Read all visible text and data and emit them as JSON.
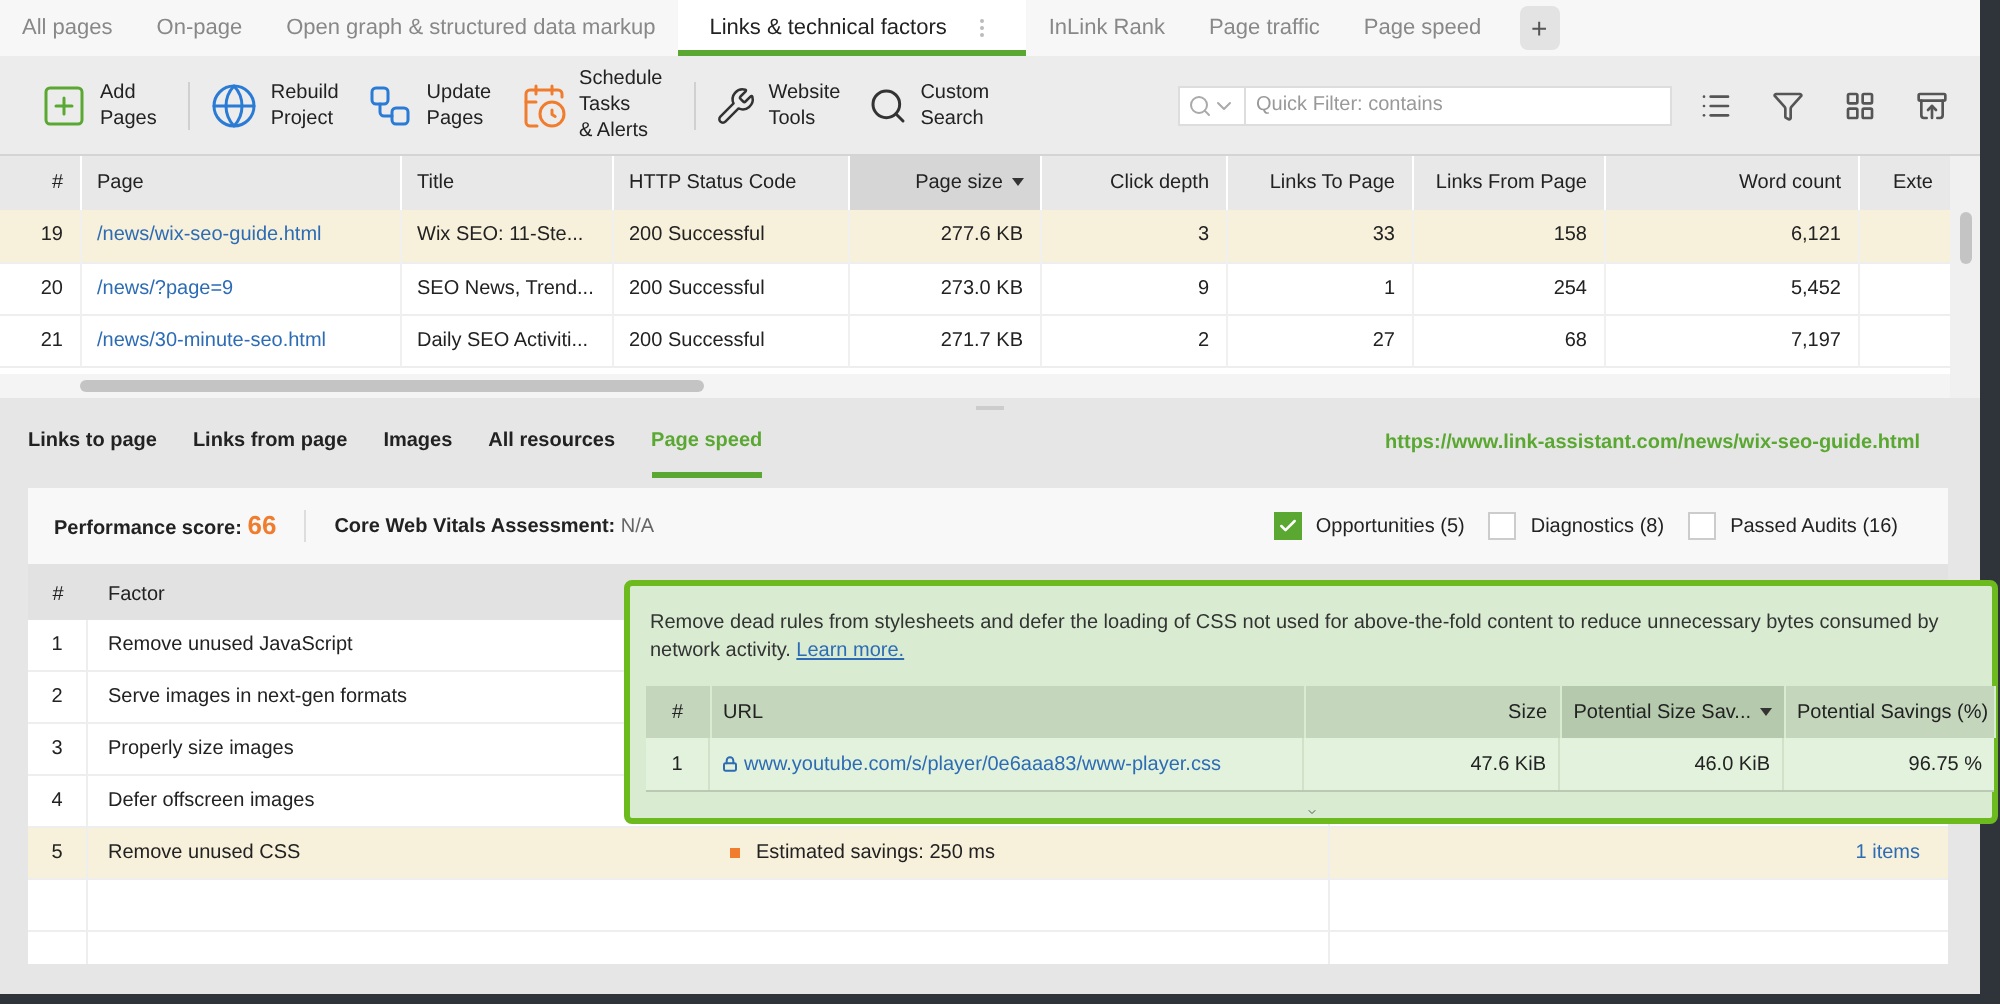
{
  "tabs": [
    {
      "label": "All pages",
      "selected": false
    },
    {
      "label": "On-page",
      "selected": false
    },
    {
      "label": "Open graph & structured data markup",
      "selected": false
    },
    {
      "label": "Links & technical factors",
      "selected": true
    },
    {
      "label": "InLink Rank",
      "selected": false
    },
    {
      "label": "Page traffic",
      "selected": false
    },
    {
      "label": "Page speed",
      "selected": false
    }
  ],
  "add_tab": "+",
  "toolbar": [
    {
      "kind": "add",
      "label": "Add\nPages"
    },
    {
      "kind": "rebuild",
      "label": "Rebuild\nProject"
    },
    {
      "kind": "update",
      "label": "Update\nPages"
    },
    {
      "kind": "schedule",
      "label": "Schedule\nTasks\n& Alerts"
    },
    {
      "kind": "tools",
      "label": "Website\nTools"
    },
    {
      "kind": "search",
      "label": "Custom\nSearch"
    }
  ],
  "quick_filter": {
    "placeholder": "Quick Filter: contains"
  },
  "table": {
    "columns": [
      {
        "label": "#",
        "sorted": false
      },
      {
        "label": "Page",
        "sorted": false
      },
      {
        "label": "Title",
        "sorted": false
      },
      {
        "label": "HTTP Status Code",
        "sorted": false
      },
      {
        "label": "Page size",
        "sorted": true
      },
      {
        "label": "Click depth",
        "sorted": false
      },
      {
        "label": "Links To Page",
        "sorted": false
      },
      {
        "label": "Links From Page",
        "sorted": false
      },
      {
        "label": "Word count",
        "sorted": false
      },
      {
        "label": "Exte",
        "sorted": false
      }
    ],
    "rows": [
      {
        "selected": true,
        "cells": [
          "19",
          "/news/wix-seo-guide.html",
          "Wix SEO: 11-Ste...",
          "200 Successful",
          "277.6 KB",
          "3",
          "33",
          "158",
          "6,121",
          ""
        ]
      },
      {
        "selected": false,
        "cells": [
          "20",
          "/news/?page=9",
          "SEO News, Trend...",
          "200 Successful",
          "273.0 KB",
          "9",
          "1",
          "254",
          "5,452",
          ""
        ]
      },
      {
        "selected": false,
        "cells": [
          "21",
          "/news/30-minute-seo.html",
          "Daily SEO Activiti...",
          "200 Successful",
          "271.7 KB",
          "2",
          "27",
          "68",
          "7,197",
          ""
        ]
      }
    ]
  },
  "detail_tabs": [
    {
      "label": "Links to page",
      "selected": false
    },
    {
      "label": "Links from page",
      "selected": false
    },
    {
      "label": "Images",
      "selected": false
    },
    {
      "label": "All resources",
      "selected": false
    },
    {
      "label": "Page speed",
      "selected": true
    }
  ],
  "page_url": "https://www.link-assistant.com/news/wix-seo-guide.html",
  "performance": {
    "label": "Performance score:",
    "value": "66"
  },
  "core_web_vitals": {
    "label": "Core Web Vitals Assessment:",
    "value": "N/A"
  },
  "filters": [
    {
      "label": "Opportunities (5)",
      "checked": true
    },
    {
      "label": "Diagnostics (8)",
      "checked": false
    },
    {
      "label": "Passed Audits (16)",
      "checked": false
    }
  ],
  "factors": {
    "columns": [
      "#",
      "Factor"
    ],
    "rows": [
      {
        "number": "1",
        "factor": "Remove unused JavaScript",
        "selected": false
      },
      {
        "number": "2",
        "factor": "Serve images in next-gen formats",
        "selected": false
      },
      {
        "number": "3",
        "factor": "Properly size images",
        "selected": false
      },
      {
        "number": "4",
        "factor": "Defer offscreen images",
        "selected": false
      },
      {
        "number": "5",
        "factor": "Remove unused CSS",
        "savings": "Estimated savings: 250 ms",
        "items": "1 items",
        "selected": true
      }
    ]
  },
  "popup": {
    "description": "Remove dead rules from stylesheets and defer the loading of CSS not used for above-the-fold content to reduce unnecessary bytes consumed by network activity.",
    "link": "Learn more.",
    "columns": [
      {
        "label": "#",
        "sorted": false
      },
      {
        "label": "URL",
        "sorted": false
      },
      {
        "label": "Size",
        "sorted": false
      },
      {
        "label": "Potential Size Sav...",
        "sorted": true
      },
      {
        "label": "Potential Savings (%)",
        "sorted": false
      }
    ],
    "rows": [
      {
        "number": "1",
        "url": "www.youtube.com/s/player/0e6aaa83/www-player.css",
        "size": "47.6 KiB",
        "potential_size": "46.0 KiB",
        "potential_percent": "96.75 %"
      }
    ]
  }
}
